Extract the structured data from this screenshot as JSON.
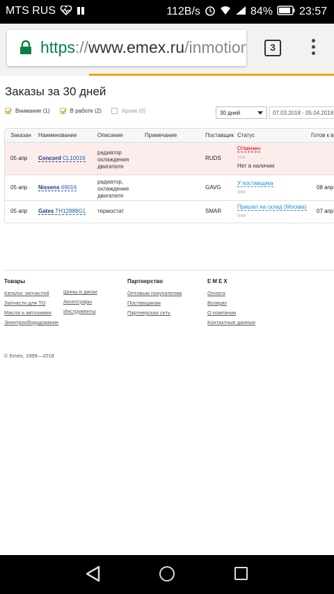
{
  "statusbar": {
    "carrier": "MTS RUS",
    "speed": "112B/s",
    "battery": "84%",
    "time": "23:57"
  },
  "browser": {
    "url_scheme": "https",
    "url_sep": "://",
    "url_host": "www.emex.ru",
    "url_path": "/inmotion",
    "tab_count": "3"
  },
  "page": {
    "title": "Заказы за 30 дней",
    "filters": [
      {
        "label": "Внимание (1)",
        "checked": true
      },
      {
        "label": "В работе (2)",
        "checked": true
      },
      {
        "label": "Архив (0)",
        "checked": false
      }
    ],
    "period_select": "30 дней",
    "date_range": "07.03.2018 - 05.04.2018"
  },
  "table": {
    "headers": [
      "Заказан",
      "Наименование",
      "Описание",
      "Примечание",
      "Поставщик",
      "Статус",
      "Готов к в"
    ],
    "rows": [
      {
        "date": "05 апр",
        "brand": "Concord",
        "part": "CL10016",
        "desc": [
          "радиатор",
          "охлаждения",
          "двигателя"
        ],
        "supplier": "RUDS",
        "status": "Отменен",
        "status_note": "Нет в наличии",
        "ready": "",
        "progress": 2
      },
      {
        "date": "05 апр",
        "brand": "Nissens",
        "part": "69016",
        "desc": [
          "радиатор,",
          "охлаждение",
          "двигателя"
        ],
        "supplier": "GAVG",
        "status": "У поставщика",
        "status_note": "",
        "ready": "08 апр",
        "progress": 1
      },
      {
        "date": "05 апр",
        "brand": "Gates",
        "part": "TH12888G1",
        "desc": [
          "термостат"
        ],
        "supplier": "SMAR",
        "status": "Пришел на склад (Москва)",
        "status_note": "",
        "ready": "07 апр",
        "progress": 3
      }
    ]
  },
  "footer": {
    "col1": {
      "title": "Товары",
      "links": [
        "Каталог запчастей",
        "Запчасти для ТО",
        "Масла и автохимия",
        "Электрооборудование"
      ]
    },
    "col2": {
      "links": [
        "Шины и диски",
        "Аксессуары",
        "Инструменты"
      ]
    },
    "col3": {
      "title": "Партнерство",
      "links": [
        "Оптовым покупателям",
        "Поставщикам",
        "Партнерская сеть"
      ]
    },
    "col4": {
      "title": "EMEX",
      "links": [
        "Оплата",
        "Возврат",
        "О компании",
        "Контактные данные"
      ]
    },
    "copyright": "© Emex, 1999—2018"
  }
}
